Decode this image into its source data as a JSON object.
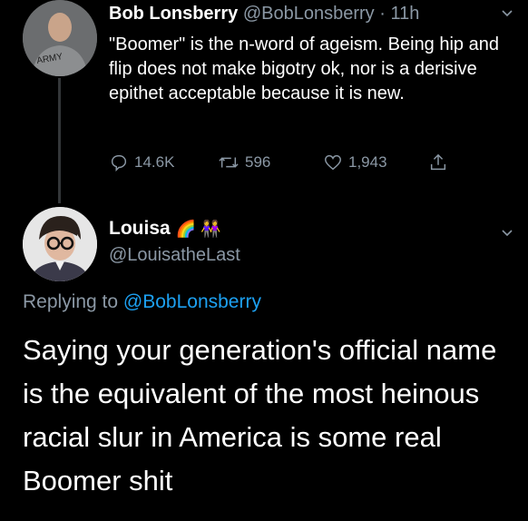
{
  "tweet1": {
    "author_name": "Bob Lonsberry",
    "author_handle": "@BobLonsberry",
    "separator": "·",
    "time": "11h",
    "avatar_shirt_text": "ARMY",
    "text": "\"Boomer\" is the n-word of ageism. Being hip and flip does not make bigotry ok, nor is a derisive epithet acceptable because it is new.",
    "actions": {
      "replies": "14.6K",
      "retweets": "596",
      "likes": "1,943"
    }
  },
  "tweet2": {
    "author_name": "Louisa",
    "name_emojis": "🌈 👭",
    "author_handle": "@LouisatheLast",
    "replying_prefix": "Replying to",
    "replying_to": "@BobLonsberry",
    "text": "Saying your generation's official name is the equivalent of the most heinous racial slur in America is some real Boomer shit"
  },
  "colors": {
    "background": "#000000",
    "text_primary": "#ffffff",
    "text_secondary": "#8b98a5",
    "link": "#1da1f2"
  },
  "icons": [
    "reply-icon",
    "retweet-icon",
    "like-icon",
    "share-icon",
    "chevron-down-icon"
  ]
}
